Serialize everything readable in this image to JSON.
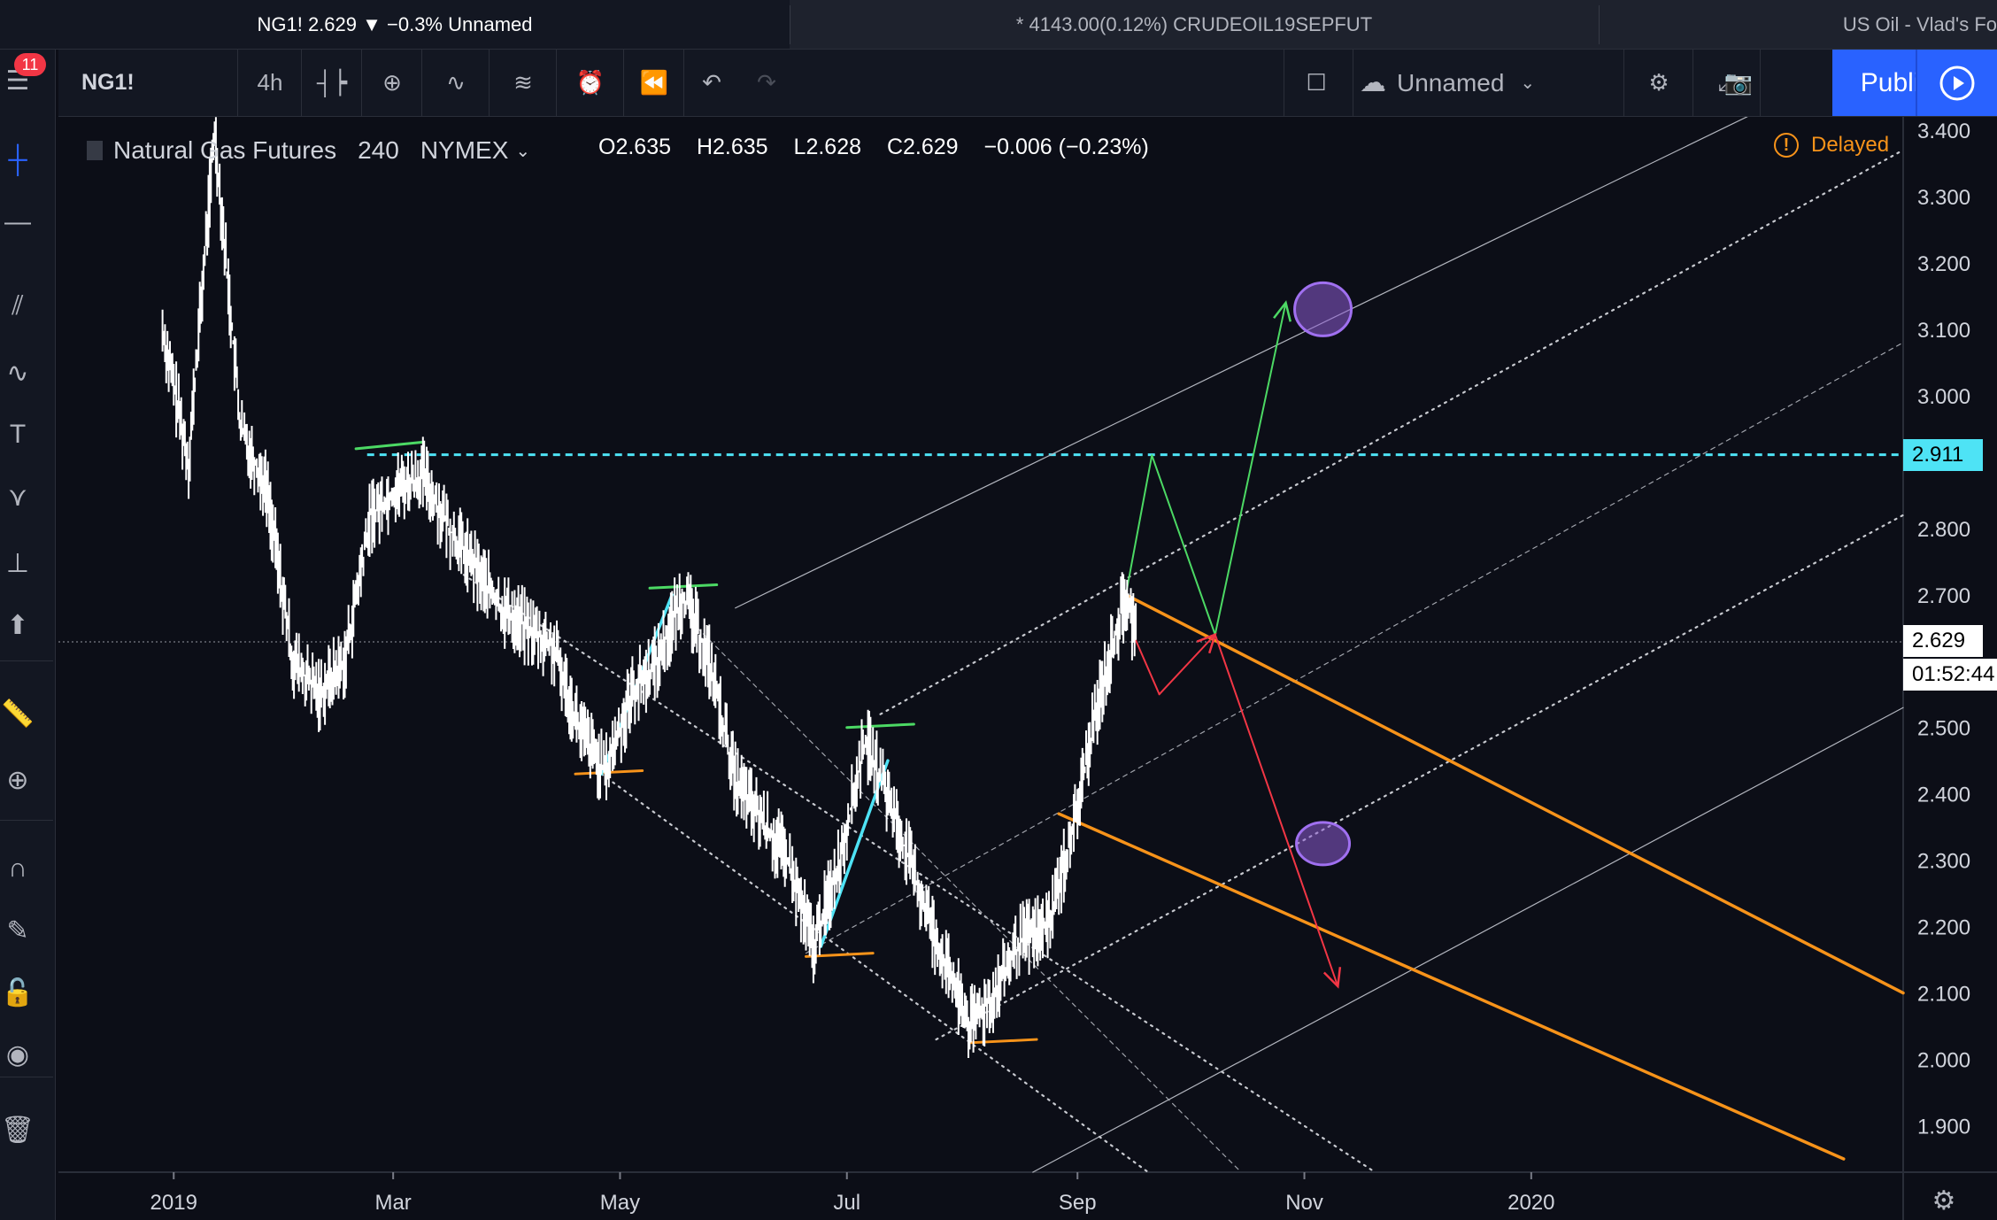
{
  "tabs": [
    {
      "label": "NG1! 2.629 ▼ −0.3% Unnamed",
      "active": true
    },
    {
      "label": "* 4143.00(0.12%) CRUDEOIL19SEPFUT",
      "active": false
    },
    {
      "label": "US Oil - Vlad's Fo",
      "active": false
    }
  ],
  "leftbar": {
    "badge_count": "11"
  },
  "toolbar": {
    "symbol": "NG1!",
    "interval": "4h",
    "layout_name": "Unnamed",
    "publish_label": "Publish"
  },
  "legend": {
    "title": "Natural Gas Futures",
    "interval": "240",
    "exchange": "NYMEX",
    "open": "O2.635",
    "high": "H2.635",
    "low": "L2.628",
    "close": "C2.629",
    "change": "−0.006 (−0.23%)",
    "delayed_label": "Delayed"
  },
  "price_tags": {
    "level": "2.911",
    "last": "2.629",
    "countdown": "01:52:44"
  },
  "colors": {
    "background": "#0c0e17",
    "cyan_level": "#4ee3f5",
    "green_level": "#4cd964",
    "orange_channel": "#f7931a",
    "red_arrow": "#f23645",
    "purple_target": "#8c5bd1",
    "publish_blue": "#2962ff"
  },
  "chart_data": {
    "type": "line",
    "series_name": "Natural Gas Futures (NG1!) 240",
    "x_axis_labels": [
      "2019",
      "Mar",
      "May",
      "Jul",
      "Sep",
      "Nov",
      "2020"
    ],
    "y_axis_labels": [
      "3.400",
      "3.300",
      "3.200",
      "3.100",
      "3.000",
      "2.800",
      "2.700",
      "2.500",
      "2.400",
      "2.300",
      "2.200",
      "2.100",
      "2.000",
      "1.900"
    ],
    "ylim": [
      1.83,
      3.42
    ],
    "xlim": [
      "2018-12-01",
      "2020-04-10"
    ],
    "horizontal_level": 2.911,
    "last_price": 2.629,
    "price_path": [
      {
        "x": "2018-12-29",
        "y": 3.1
      },
      {
        "x": "2019-01-05",
        "y": 2.9
      },
      {
        "x": "2019-01-12",
        "y": 3.4
      },
      {
        "x": "2019-01-19",
        "y": 2.95
      },
      {
        "x": "2019-01-26",
        "y": 2.86
      },
      {
        "x": "2019-02-02",
        "y": 2.6
      },
      {
        "x": "2019-02-09",
        "y": 2.55
      },
      {
        "x": "2019-02-16",
        "y": 2.6
      },
      {
        "x": "2019-02-23",
        "y": 2.82
      },
      {
        "x": "2019-03-02",
        "y": 2.86
      },
      {
        "x": "2019-03-09",
        "y": 2.88
      },
      {
        "x": "2019-03-16",
        "y": 2.8
      },
      {
        "x": "2019-03-23",
        "y": 2.74
      },
      {
        "x": "2019-03-30",
        "y": 2.68
      },
      {
        "x": "2019-04-06",
        "y": 2.65
      },
      {
        "x": "2019-04-13",
        "y": 2.62
      },
      {
        "x": "2019-04-20",
        "y": 2.5
      },
      {
        "x": "2019-04-27",
        "y": 2.43
      },
      {
        "x": "2019-05-04",
        "y": 2.55
      },
      {
        "x": "2019-05-11",
        "y": 2.6
      },
      {
        "x": "2019-05-18",
        "y": 2.7
      },
      {
        "x": "2019-05-25",
        "y": 2.6
      },
      {
        "x": "2019-06-01",
        "y": 2.42
      },
      {
        "x": "2019-06-08",
        "y": 2.36
      },
      {
        "x": "2019-06-15",
        "y": 2.3
      },
      {
        "x": "2019-06-22",
        "y": 2.17
      },
      {
        "x": "2019-06-29",
        "y": 2.3
      },
      {
        "x": "2019-07-06",
        "y": 2.48
      },
      {
        "x": "2019-07-13",
        "y": 2.38
      },
      {
        "x": "2019-07-20",
        "y": 2.26
      },
      {
        "x": "2019-07-27",
        "y": 2.15
      },
      {
        "x": "2019-08-03",
        "y": 2.05
      },
      {
        "x": "2019-08-10",
        "y": 2.1
      },
      {
        "x": "2019-08-17",
        "y": 2.18
      },
      {
        "x": "2019-08-24",
        "y": 2.2
      },
      {
        "x": "2019-08-31",
        "y": 2.35
      },
      {
        "x": "2019-09-07",
        "y": 2.55
      },
      {
        "x": "2019-09-14",
        "y": 2.7
      },
      {
        "x": "2019-09-17",
        "y": 2.629
      }
    ]
  }
}
